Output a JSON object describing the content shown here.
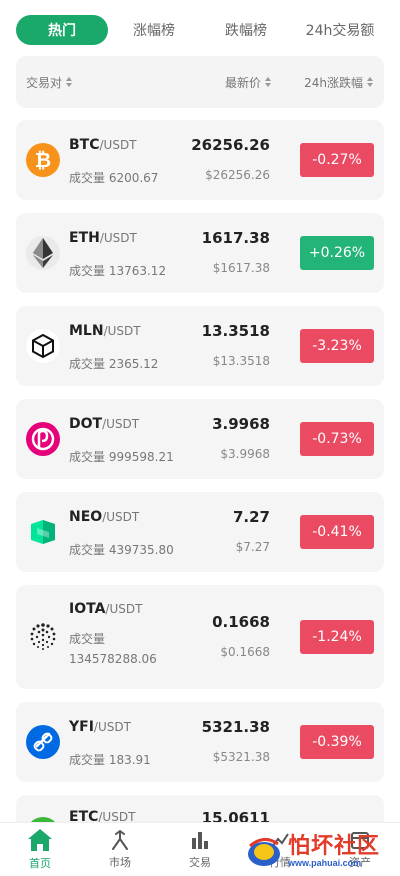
{
  "tabs": [
    {
      "label": "热门",
      "active": true
    },
    {
      "label": "涨幅榜",
      "active": false
    },
    {
      "label": "跌幅榜",
      "active": false
    },
    {
      "label": "24h交易额",
      "active": false
    }
  ],
  "header": {
    "pair": "交易对",
    "price": "最新价",
    "change": "24h涨跌幅"
  },
  "rows": [
    {
      "base": "BTC",
      "quote": "/USDT",
      "volume": "成交量 6200.67",
      "price": "26256.26",
      "price_sub": "$26256.26",
      "change": "-0.27%",
      "direction": "down",
      "icon": "btc-icon"
    },
    {
      "base": "ETH",
      "quote": "/USDT",
      "volume": "成交量 13763.12",
      "price": "1617.38",
      "price_sub": "$1617.38",
      "change": "+0.26%",
      "direction": "up",
      "icon": "eth-icon"
    },
    {
      "base": "MLN",
      "quote": "/USDT",
      "volume": "成交量 2365.12",
      "price": "13.3518",
      "price_sub": "$13.3518",
      "change": "-3.23%",
      "direction": "down",
      "icon": "mln-icon"
    },
    {
      "base": "DOT",
      "quote": "/USDT",
      "volume": "成交量 999598.21",
      "price": "3.9968",
      "price_sub": "$3.9968",
      "change": "-0.73%",
      "direction": "down",
      "icon": "dot-icon"
    },
    {
      "base": "NEO",
      "quote": "/USDT",
      "volume": "成交量 439735.80",
      "price": "7.27",
      "price_sub": "$7.27",
      "change": "-0.41%",
      "direction": "down",
      "icon": "neo-icon"
    },
    {
      "base": "IOTA",
      "quote": "/USDT",
      "volume": "成交量 134578288.06",
      "price": "0.1668",
      "price_sub": "$0.1668",
      "change": "-1.24%",
      "direction": "down",
      "icon": "iota-icon"
    },
    {
      "base": "YFI",
      "quote": "/USDT",
      "volume": "成交量 183.91",
      "price": "5321.38",
      "price_sub": "$5321.38",
      "change": "-0.39%",
      "direction": "down",
      "icon": "yfi-icon"
    },
    {
      "base": "ETC",
      "quote": "/USDT",
      "volume": "",
      "price": "15.0611",
      "price_sub": "",
      "change": "",
      "direction": "down",
      "icon": "etc-icon"
    }
  ],
  "nav": [
    {
      "label": "首页",
      "icon": "home-icon",
      "active": true
    },
    {
      "label": "市场",
      "icon": "market-icon",
      "active": false
    },
    {
      "label": "交易",
      "icon": "trade-icon",
      "active": false
    },
    {
      "label": "行情",
      "icon": "quotes-icon",
      "active": false
    },
    {
      "label": "资产",
      "icon": "assets-icon",
      "active": false
    }
  ],
  "watermark": {
    "text": "怕坏社区",
    "url": "www.pahuai.com"
  },
  "colors": {
    "accent": "#1aa86b",
    "down": "#ea4a62",
    "up": "#23b477"
  }
}
